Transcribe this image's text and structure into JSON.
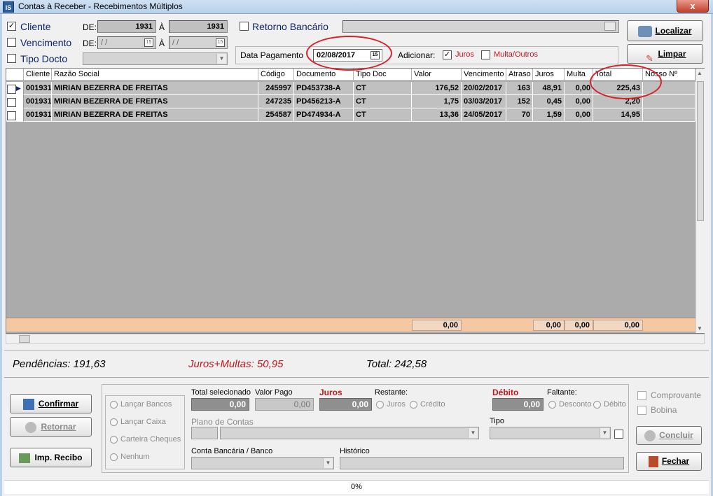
{
  "window": {
    "title": "Contas à Receber - Recebimentos Múltiplos",
    "app_icon": "IS",
    "close": "x"
  },
  "filters": {
    "cliente": {
      "label": "Cliente",
      "checked": "✓",
      "de_label": "DE:",
      "de_value": "1931",
      "a_label": "À",
      "a_value": "1931"
    },
    "vencimento": {
      "label": "Vencimento",
      "de_label": "DE:",
      "de_value": "/ /",
      "a_label": "À",
      "a_value": "/ /",
      "cal_label": "15"
    },
    "tipo_docto": {
      "label": "Tipo Docto"
    },
    "retorno": {
      "label": "Retorno Bancário"
    },
    "data_pagamento": {
      "label": "Data Pagamento",
      "value": "02/08/2017",
      "cal_label": "15"
    },
    "adicionar": {
      "label": "Adicionar:",
      "juros_label": "Juros",
      "juros_checked": "✓",
      "multa_label": "Multa/Outros"
    }
  },
  "buttons": {
    "localizar": "Localizar",
    "limpar": "Limpar"
  },
  "grid": {
    "headers": [
      "Cliente",
      "Razão Social",
      "Código",
      "Documento",
      "Tipo Doc",
      "Valor",
      "Vencimento",
      "Atraso",
      "Juros",
      "Multa",
      "Total",
      "Nosso Nº"
    ],
    "rows": [
      [
        "001931",
        "MIRIAN BEZERRA DE FREITAS",
        "245997",
        "PD453738-A",
        "CT",
        "176,52",
        "20/02/2017",
        "163",
        "48,91",
        "0,00",
        "225,43",
        ""
      ],
      [
        "001931",
        "MIRIAN BEZERRA DE FREITAS",
        "247235",
        "PD456213-A",
        "CT",
        "1,75",
        "03/03/2017",
        "152",
        "0,45",
        "0,00",
        "2,20",
        ""
      ],
      [
        "001931",
        "MIRIAN BEZERRA DE FREITAS",
        "254587",
        "PD474934-A",
        "CT",
        "13,36",
        "24/05/2017",
        "70",
        "1,59",
        "0,00",
        "14,95",
        ""
      ]
    ],
    "footer": {
      "valor": "0,00",
      "juros": "0,00",
      "multa": "0,00",
      "total": "0,00"
    }
  },
  "summary": {
    "pendencias": "Pendências: 191,63",
    "juros_multas": "Juros+Multas: 50,95",
    "total": "Total: 242,58"
  },
  "actions": {
    "confirmar": "Confirmar",
    "retornar": "Retornar",
    "imp_recibo": "Imp. Recibo",
    "concluir": "Concluir",
    "fechar": "Fechar"
  },
  "lancamento": {
    "options": [
      "Lançar Bancos",
      "Lançar Caixa",
      "Carteira Cheques",
      "Nenhum"
    ],
    "total_selecionado_label": "Total selecionado",
    "total_selecionado": "0,00",
    "valor_pago_label": "Valor Pago",
    "valor_pago": "0,00",
    "juros_label": "Juros",
    "juros": "0,00",
    "restante_label": "Restante:",
    "restante_opts": [
      "Juros",
      "Crédito"
    ],
    "debito_label": "Débito",
    "debito": "0,00",
    "faltante_label": "Faltante:",
    "faltante_opts": [
      "Desconto",
      "Débito"
    ],
    "plano_contas_label": "Plano de Contas",
    "tipo_label": "Tipo",
    "conta_bancaria_label": "Conta Bancária / Banco",
    "historico_label": "Histórico",
    "comprovante": "Comprovante",
    "bobina": "Bobina"
  },
  "status": {
    "progress": "0%"
  },
  "colors": {
    "accent_red": "#c4161c",
    "footer_row": "#f5c8a4",
    "annotation": "#d8202a"
  }
}
